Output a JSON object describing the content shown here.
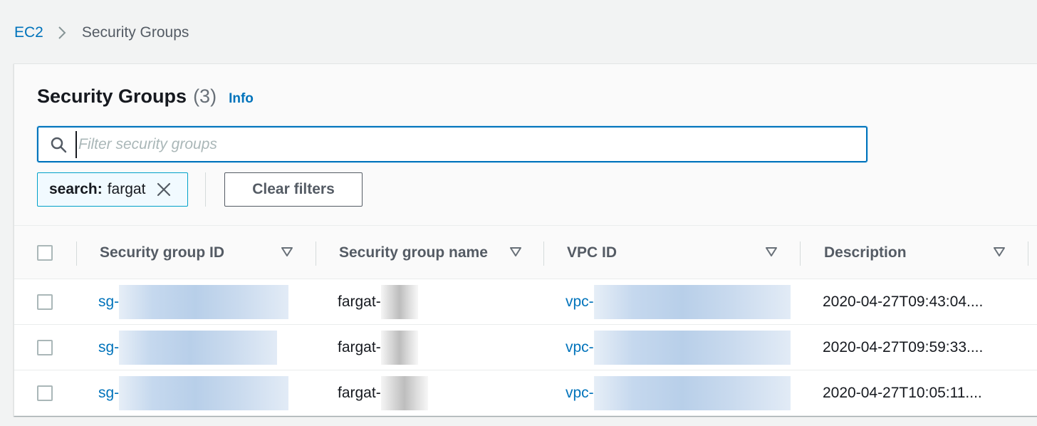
{
  "breadcrumb": {
    "root": "EC2",
    "current": "Security Groups"
  },
  "panel": {
    "title": "Security Groups",
    "count": "(3)",
    "info_label": "Info"
  },
  "search": {
    "placeholder": "Filter security groups",
    "value": ""
  },
  "filter_token": {
    "key": "search:",
    "value": "fargat"
  },
  "clear_filters_label": "Clear filters",
  "table": {
    "columns": [
      "Security group ID",
      "Security group name",
      "VPC ID",
      "Description"
    ],
    "rows": [
      {
        "id": "sg-",
        "name": "fargat-",
        "vpc": "vpc-",
        "description": "2020-04-27T09:43:04...."
      },
      {
        "id": "sg-",
        "name": "fargat-",
        "vpc": "vpc-",
        "description": "2020-04-27T09:59:33...."
      },
      {
        "id": "sg-",
        "name": "fargat-",
        "vpc": "vpc-",
        "description": "2020-04-27T10:05:11...."
      }
    ]
  },
  "colors": {
    "link": "#0073bb",
    "focus_border": "#0073bb",
    "token_bg": "#f1faff",
    "token_border": "#00a1c9",
    "page_bg": "#f2f3f3"
  },
  "icons": {
    "breadcrumb_separator": "chevron-right-icon",
    "search": "search-icon",
    "token_remove": "close-icon",
    "sort": "caret-down-icon"
  }
}
